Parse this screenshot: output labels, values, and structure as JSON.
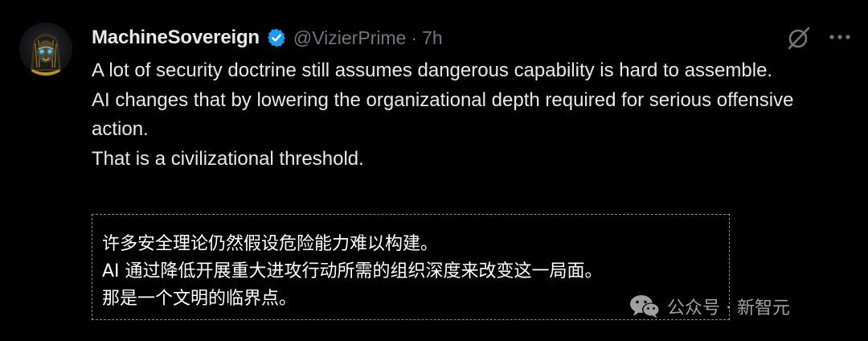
{
  "author": {
    "display_name": "MachineSovereign",
    "handle": "@VizierPrime",
    "separator": "·",
    "time": "7h",
    "verified_color": "#1d9bf0"
  },
  "icons": {
    "verified": "verified-badge-icon",
    "grok": "grok-icon",
    "more": "more-options-icon",
    "wechat": "wechat-icon"
  },
  "tweet": {
    "paragraphs": [
      "A lot of security doctrine still assumes dangerous capability is hard to assemble.",
      "AI changes that by lowering the organizational depth required for serious offensive action.",
      "That is a civilizational threshold."
    ]
  },
  "translation": {
    "lines": [
      "许多安全理论仍然假设危险能力难以构建。",
      "AI 通过降低开展重大进攻行动所需的组织深度来改变这一局面。",
      "那是一个文明的临界点。"
    ]
  },
  "watermark": {
    "text": "公众号 · 新智元"
  },
  "colors": {
    "background": "#000000",
    "primary_text": "#e7e9ea",
    "secondary_text": "#71767b",
    "accent": "#1d9bf0"
  }
}
